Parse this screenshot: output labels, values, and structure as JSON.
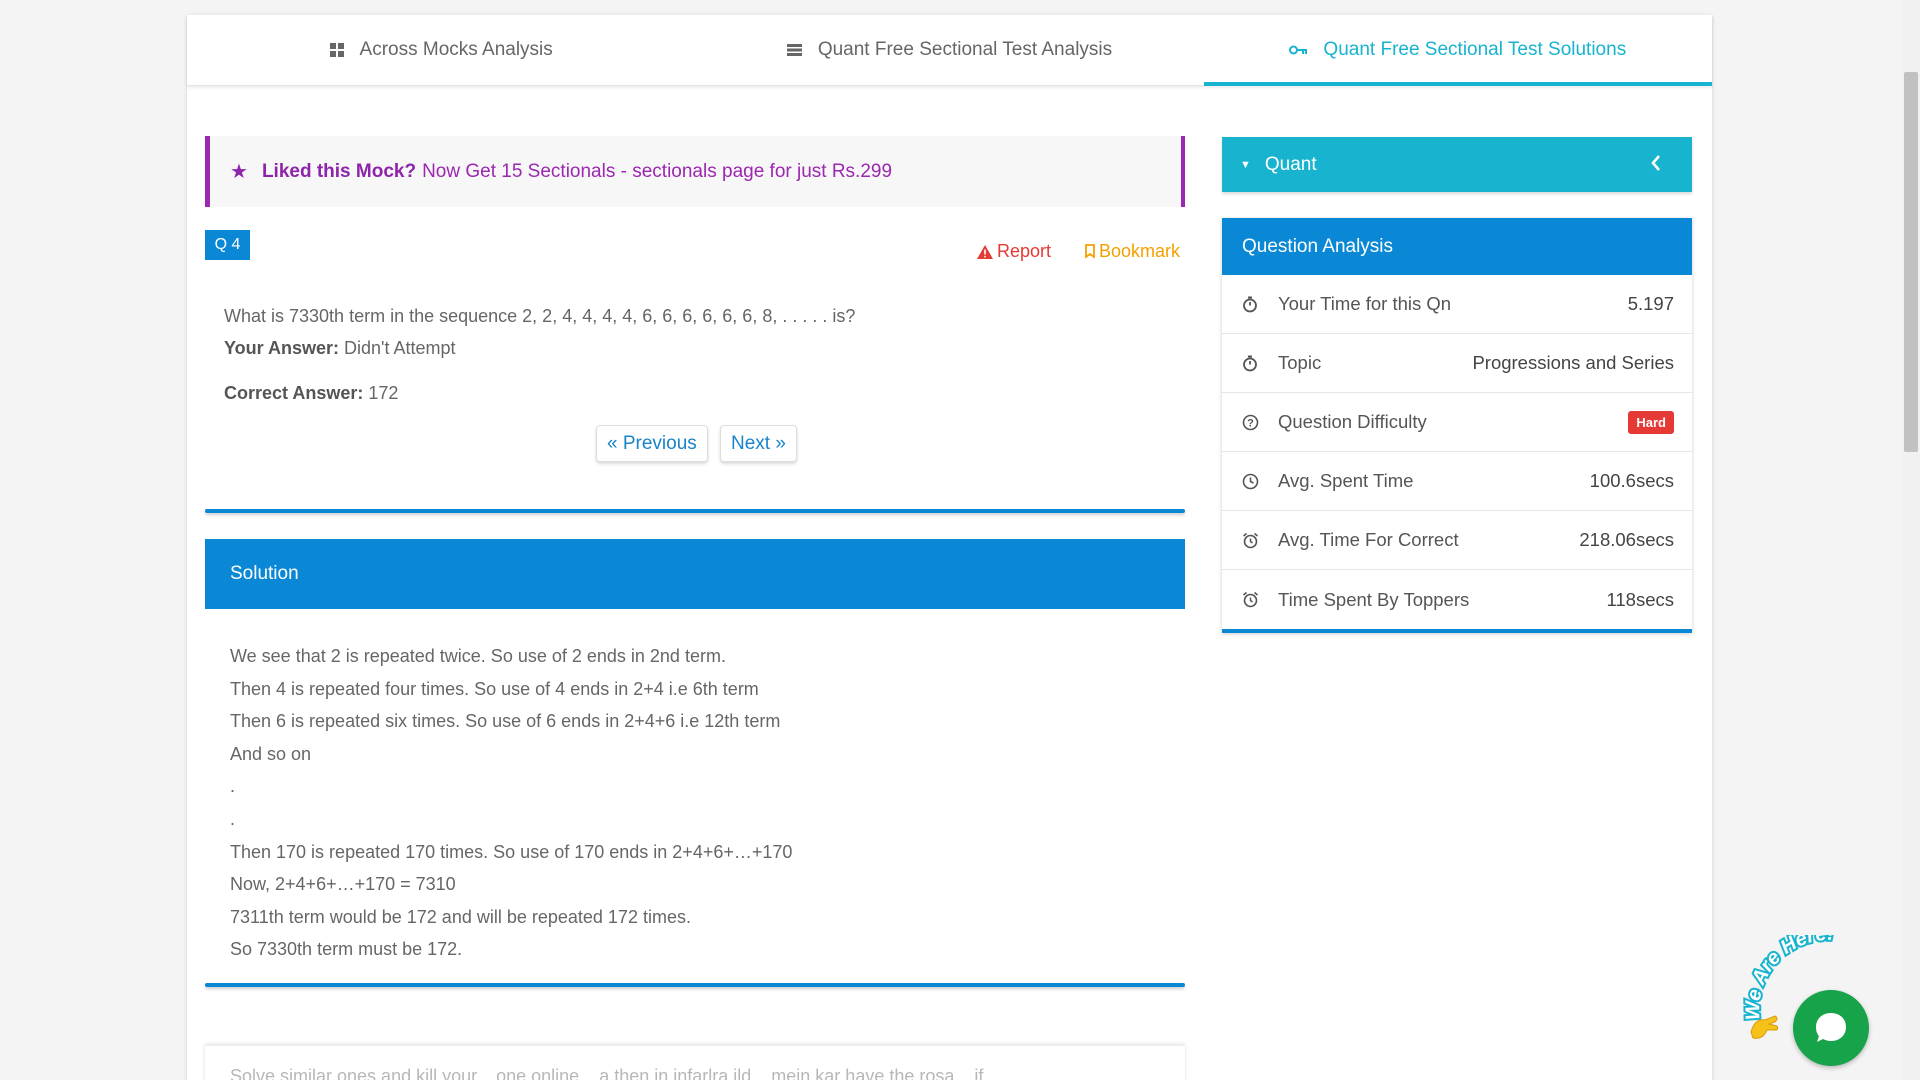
{
  "tabs": [
    {
      "label": "Across Mocks Analysis",
      "icon": "grid-icon"
    },
    {
      "label": "Quant Free Sectional Test Analysis",
      "icon": "list-icon"
    },
    {
      "label": "Quant Free Sectional Test Solutions",
      "icon": "key-icon",
      "active": true
    }
  ],
  "promo": {
    "bold": "Liked this Mock?",
    "link": "Now Get 15 Sectionals - sectionals page for just Rs.299"
  },
  "question": {
    "number": "Q 4",
    "report": "Report",
    "bookmark": "Bookmark",
    "text": "What is 7330th term in the sequence 2, 2, 4, 4, 4, 4, 6, 6, 6, 6, 6, 6, 8, . . . . . is?",
    "your_answer_label": "Your Answer:",
    "your_answer": "Didn't Attempt",
    "correct_answer_label": "Correct Answer:",
    "correct_answer": "172",
    "prev_label": "« Previous",
    "next_label": "Next »"
  },
  "solution": {
    "title": "Solution",
    "lines": [
      "We see that 2 is repeated twice. So use of 2 ends in 2nd term.",
      "Then 4 is repeated four times. So use of 4 ends in 2+4 i.e 6th term",
      "Then 6 is repeated six times. So use of 6 ends in 2+4+6 i.e 12th term",
      "And so on",
      ".",
      ".",
      "Then 170 is repeated 170 times. So use of 170 ends in 2+4+6+…+170",
      "Now, 2+4+6+…+170 = 7310",
      "7311th term would be 172 and will be repeated 172 times.",
      "So 7330th term must be 172."
    ],
    "next_card_text": "Solve similar ones and kill your... one online... a then in infarlra ild... mein kar have the rosa... if"
  },
  "sidebar": {
    "section_title": "Quant",
    "analysis_title": "Question Analysis",
    "rows": [
      {
        "icon": "stopwatch-icon",
        "label": "Your Time for this Qn",
        "value": "5.197"
      },
      {
        "icon": "stopwatch-icon",
        "label": "Topic",
        "value": "Progressions and Series"
      },
      {
        "icon": "question-circle-icon",
        "label": "Question Difficulty",
        "value": "Hard",
        "badge": true
      },
      {
        "icon": "clock-icon",
        "label": "Avg. Spent Time",
        "value": "100.6secs"
      },
      {
        "icon": "alarm-icon",
        "label": "Avg. Time For Correct",
        "value": "218.06secs"
      },
      {
        "icon": "alarm-icon",
        "label": "Time Spent By Toppers",
        "value": "118secs"
      }
    ]
  },
  "chat": {
    "label": "We Are Here!"
  },
  "colors": {
    "primary": "#0a88d6",
    "accent": "#17b3cf",
    "promo": "#9c27b0",
    "danger": "#e53935",
    "warning": "#f5a000",
    "chat": "#16a34a"
  }
}
